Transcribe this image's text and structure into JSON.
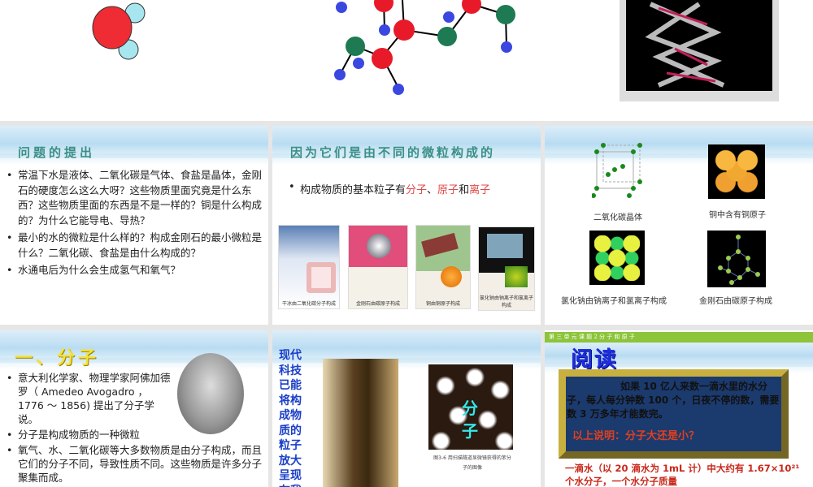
{
  "slides": [
    {
      "id": "top-row",
      "images": [
        "water-molecule",
        "molecule-model",
        "dna-model"
      ]
    },
    {
      "title": "问题的提出",
      "bullets": [
        "常温下水是液体、二氧化碳是气体、食盐是晶体，金刚石的硬度怎么这么大呀？这些物质里面究竟是什么东西？这些物质里面的东西是不是一样的？铜是什么构成的？为什么它能导电、导热？",
        "最小的水的微粒是什么样的？构成金刚石的最小微粒是什么？二氧化碳、食盐是由什么构成的？",
        "水通电后为什么会生成氢气和氧气？"
      ]
    },
    {
      "title": "因为它们是由不同的微粒构成的",
      "bullet_prefix": "构成物质的基本粒子有",
      "molecule": "分子",
      "sep": "、",
      "atom": "原子",
      "and": "和",
      "ion": "离子",
      "photos": [
        "干冰由二氧化碳分子构成",
        "金刚石由碳原子构成",
        "铜由铜原子构成",
        "氯化钠由钠离子和氯离子构成"
      ]
    },
    {
      "captions": [
        "二氧化碳晶体",
        "铜中含有铜原子",
        "氯化钠由钠离子和氯离子构成",
        "金刚石由碳原子构成"
      ]
    },
    {
      "title": "一、分子",
      "bullets": [
        "意大利化学家、物理学家阿佛加德罗（ Amedeo Avogadro ， 1776 ～ 1856) 提出了分子学说。",
        "分子是构成物质的一种微粒",
        "氧气、水、二氧化碳等大多数物质是由分子构成，而且它们的分子不同，导致性质不同。这些物质是许多分子聚集而成。"
      ]
    },
    {
      "vertical_text": "现代科技已能将构成物质的粒子放大呈现在我",
      "overlay": "分子",
      "fig_caption": "图3-6 用扫描隧道显微镜获得的苯分子的图像"
    },
    {
      "header": "第 三 单 元 课 题 2  分 子 和 原 子",
      "title": "阅读",
      "para": "如果 10 亿人来数一滴水里的水分子，每人每分钟数 100 个，日夜不停的数，需要数 3 万多年才能数完。",
      "question": "以上说明：分子大还是小？",
      "bottom": "一滴水（以 20 滴水为 1mL 计）中大约有 1.67×10²¹ 个水分子，一个水分子质量"
    }
  ]
}
